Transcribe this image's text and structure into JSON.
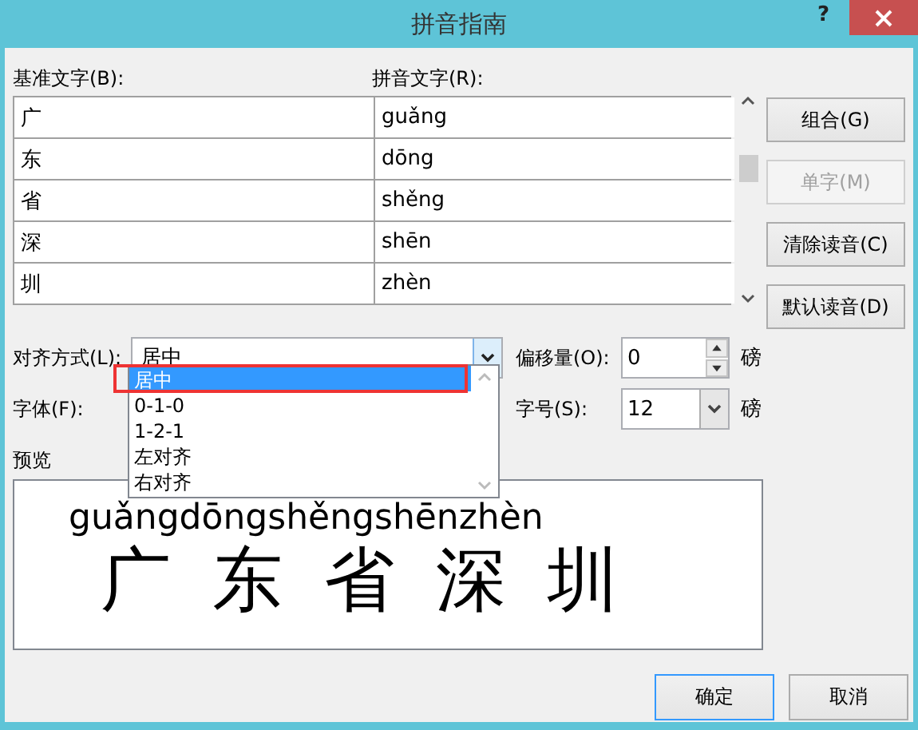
{
  "window": {
    "title": "拼音指南",
    "help": "?"
  },
  "table": {
    "base_label": "基准文字(B):",
    "ruby_label": "拼音文字(R):",
    "rows": [
      {
        "base": "广",
        "ruby": "guǎng"
      },
      {
        "base": "东",
        "ruby": "dōng"
      },
      {
        "base": "省",
        "ruby": "shěng"
      },
      {
        "base": "深",
        "ruby": "shēn"
      },
      {
        "base": "圳",
        "ruby": "zhèn"
      }
    ]
  },
  "side_buttons": [
    {
      "label": "组合(G)",
      "disabled": false
    },
    {
      "label": "单字(M)",
      "disabled": true
    },
    {
      "label": "清除读音(C)",
      "disabled": false
    },
    {
      "label": "默认读音(D)",
      "disabled": false
    }
  ],
  "alignment": {
    "label": "对齐方式(L):",
    "value": "居中",
    "expanded": true,
    "options": [
      {
        "label": "居中",
        "selected": true,
        "marked": true
      },
      {
        "label": "0-1-0",
        "selected": false,
        "marked": false
      },
      {
        "label": "1-2-1",
        "selected": false,
        "marked": false
      },
      {
        "label": "左对齐",
        "selected": false,
        "marked": false
      },
      {
        "label": "右对齐",
        "selected": false,
        "marked": false
      }
    ]
  },
  "offset": {
    "label": "偏移量(O):",
    "value": "0",
    "unit": "磅"
  },
  "font": {
    "label": "字体(F):"
  },
  "size": {
    "label": "字号(S):",
    "value": "12",
    "unit": "磅"
  },
  "preview": {
    "label": "预览",
    "ruby": "guǎngdōngshěngshēnzhèn",
    "base": [
      "广",
      "东",
      "省",
      "深",
      "圳"
    ]
  },
  "footer_buttons": [
    {
      "label": "确定",
      "default": true
    },
    {
      "label": "取消",
      "default": false
    }
  ]
}
